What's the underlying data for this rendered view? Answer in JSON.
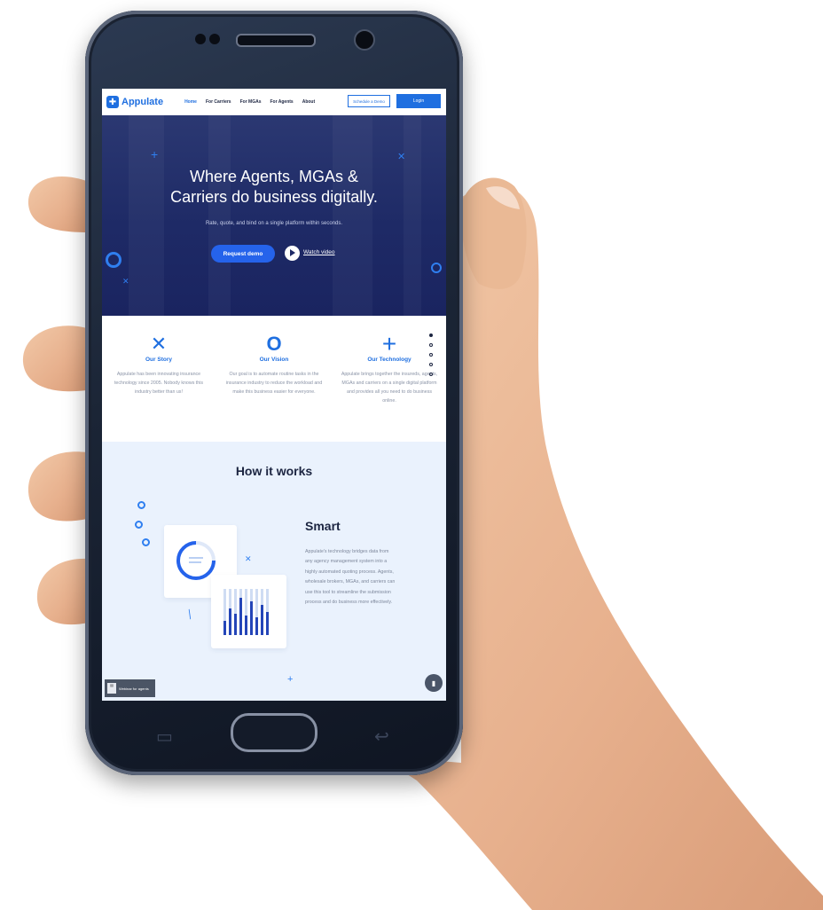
{
  "site": {
    "logo_text": "Appulate",
    "nav": [
      "Home",
      "For Carriers",
      "For MGAs",
      "For Agents",
      "About"
    ],
    "nav_active": "Home",
    "schedule_label": "Schedule a Demo",
    "login_label": "Login"
  },
  "hero": {
    "title_line1": "Where Agents, MGAs &",
    "title_line2": "Carriers do business digitally.",
    "subtitle": "Rate, quote, and bind on a single platform within seconds.",
    "request_label": "Request demo",
    "watch_label": "Watch video"
  },
  "features": [
    {
      "icon": "x-cross-icon",
      "glyph": "✕",
      "title": "Our Story",
      "text": "Appulate has been innovating insurance technology since 2005. Nobody knows this industry better than us!"
    },
    {
      "icon": "circle-icon",
      "glyph": "O",
      "title": "Our Vision",
      "text": "Our goal is to automate routine tasks in the insurance industry to reduce the workload and make this business easier for everyone."
    },
    {
      "icon": "plus-icon",
      "glyph": "+",
      "title": "Our Technology",
      "text": "Appulate brings together the insureds, agents, MGAs and carriers on a single digital platform and provides all you need to do business online."
    }
  ],
  "how": {
    "title": "How it works",
    "smart_title": "Smart",
    "smart_text": "Appulate's technology bridges data from any agency management system into a highly automated quoting process. Agents, wholesale brokers, MGAs, and carriers can use this tool to streamline the submission process and do business more effectively."
  },
  "widgets": {
    "webinar_label": "Webinar for agents"
  },
  "colors": {
    "accent": "#1f6fe0",
    "hero_bg": "#1e2a66",
    "how_bg": "#eaf2fd"
  }
}
